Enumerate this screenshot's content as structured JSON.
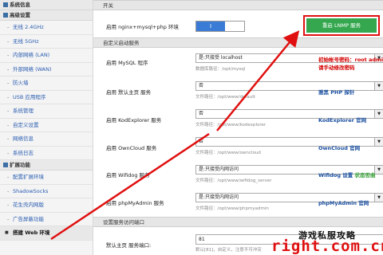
{
  "sidebar": {
    "top_item": "系统信息",
    "section1": "高级设置",
    "items1": [
      "无线 2.4GHz",
      "无线 5GHz",
      "内部网络 (LAN)",
      "外部网络 (WAN)",
      "防火墙",
      "USB 应用程序",
      "系统管理",
      "自定义设置",
      "网络信息",
      "系统日志"
    ],
    "section2": "扩展功能",
    "items2": [
      "配置扩展环境",
      "ShadowSocks",
      "花生壳内网版",
      "广告屏蔽功能",
      "搭建 Web 环境"
    ]
  },
  "main": {
    "sec_switch": "开关",
    "nginx_label": "启用 nginx+mysql+php 环境",
    "toggle_text": "I",
    "restart_btn": "重启 LNMP 服务",
    "sec_autostart": "自定义启动服务",
    "mysql_label": "启用 MySQL 程序",
    "mysql_select": "是:只接受 localhost",
    "mysql_hint": "数据库路径：/opt/mysql",
    "mysql_note1": "初始帐号密码：root admin",
    "mysql_note2": "请手动修改密码",
    "default_label": "启用 默认主页 服务",
    "default_select": "否",
    "default_hint": "文件路径：/opt/www/default",
    "default_link": "雅黑 PHP 探针",
    "kod_label": "启用 KodExplorer 服务",
    "kod_select": "否",
    "kod_hint": "文件路径：/opt/www/kodexplorer",
    "kod_link": "KodExplorer 官网",
    "owncloud_label": "启用 OwnCloud 服务",
    "owncloud_select": "否",
    "owncloud_hint": "文件路径：/opt/www/owncloud",
    "owncloud_link": "OwnCloud 官网",
    "wifidog_label": "启用 Wifidog 服务",
    "wifidog_select": "是:只接受内网访问",
    "wifidog_hint": "文件路径：/opt/www/wifidog_server",
    "wifidog_link": "Wifidog 设置",
    "wifidog_status": "状态否曲",
    "pma_label": "启用 phpMyAdmin 服务",
    "pma_select": "是:只接受内网访问",
    "pma_hint": "文件路径：/opt/www/phpmyadmin",
    "pma_link": "phpMyAdmin 官网",
    "sec_ports": "设置服务访问端口",
    "port_label": "默认主页 服务端口:",
    "port_value": "81",
    "port_hint": "默认[81]，自定义，注意不可冲突"
  },
  "watermark": {
    "cn": "游戏私服攻略",
    "en": "right.com.cn"
  },
  "colors": {
    "accent_red": "#e01010",
    "button_green": "#35a84f",
    "toggle_blue": "#3a7bd5",
    "link_blue": "#1a4fa0"
  }
}
